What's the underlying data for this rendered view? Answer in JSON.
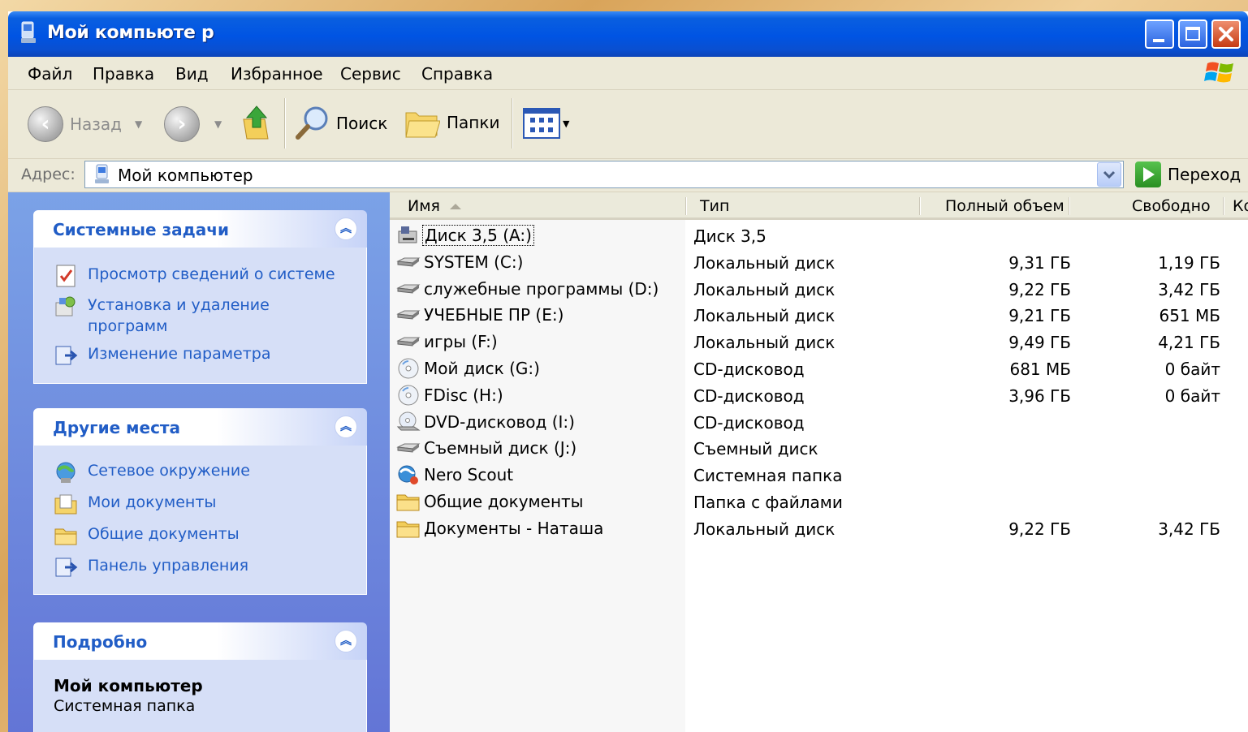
{
  "window": {
    "title": "Мой компьюте р"
  },
  "menu": [
    "Файл",
    "Правка",
    "Вид",
    "Избранное",
    "Сервис",
    "Справка"
  ],
  "toolbar": {
    "back_label": "Назад",
    "search_label": "Поиск",
    "folders_label": "Папки"
  },
  "address": {
    "label": "Адрес:",
    "value": "Мой компьютер",
    "go_label": "Переход"
  },
  "system_tasks": {
    "title": "Системные задачи",
    "items": [
      {
        "label": "Просмотр сведений о системе",
        "icon": "system-info-icon"
      },
      {
        "label": "Установка и удаление программ",
        "icon": "add-remove-programs-icon"
      },
      {
        "label": "Изменение параметра",
        "icon": "control-panel-icon"
      }
    ]
  },
  "other_places": {
    "title": "Другие места",
    "items": [
      {
        "label": "Сетевое окружение",
        "icon": "network-icon"
      },
      {
        "label": "Мои документы",
        "icon": "my-documents-icon"
      },
      {
        "label": "Общие документы",
        "icon": "folder-icon"
      },
      {
        "label": "Панель управления",
        "icon": "control-panel-icon"
      }
    ]
  },
  "details": {
    "title": "Подробно",
    "name": "Мой компьютер",
    "type": "Системная папка"
  },
  "columns": {
    "name": "Имя",
    "type": "Тип",
    "total": "Полный объем",
    "free": "Свободно",
    "extra": "Ко"
  },
  "files": [
    {
      "name": "Диск 3,5 (A:)",
      "type": "Диск 3,5",
      "total": "",
      "free": "",
      "icon": "floppy-drive-icon"
    },
    {
      "name": "SYSTEM (C:)",
      "type": "Локальный диск",
      "total": "9,31 ГБ",
      "free": "1,19 ГБ",
      "icon": "hard-drive-icon"
    },
    {
      "name": "служебные программы (D:)",
      "type": "Локальный диск",
      "total": "9,22 ГБ",
      "free": "3,42 ГБ",
      "icon": "hard-drive-icon"
    },
    {
      "name": "УЧЕБНЫЕ ПР (E:)",
      "type": "Локальный диск",
      "total": "9,21 ГБ",
      "free": "651 МБ",
      "icon": "hard-drive-icon"
    },
    {
      "name": "игры (F:)",
      "type": "Локальный диск",
      "total": "9,49 ГБ",
      "free": "4,21 ГБ",
      "icon": "hard-drive-icon"
    },
    {
      "name": "Мой диск (G:)",
      "type": "CD-дисковод",
      "total": "681 МБ",
      "free": "0 байт",
      "icon": "cd-drive-icon"
    },
    {
      "name": "FDisc (H:)",
      "type": "CD-дисковод",
      "total": "3,96 ГБ",
      "free": "0 байт",
      "icon": "cd-drive-icon"
    },
    {
      "name": "DVD-дисковод (I:)",
      "type": "CD-дисковод",
      "total": "",
      "free": "",
      "icon": "dvd-drive-icon"
    },
    {
      "name": "Съемный диск (J:)",
      "type": "Съемный диск",
      "total": "",
      "free": "",
      "icon": "removable-drive-icon"
    },
    {
      "name": "Nero Scout",
      "type": "Системная папка",
      "total": "",
      "free": "",
      "icon": "nero-scout-icon"
    },
    {
      "name": "Общие документы",
      "type": "Папка с файлами",
      "total": "",
      "free": "",
      "icon": "folder-icon"
    },
    {
      "name": "Документы - Наташа",
      "type": "Локальный диск",
      "total": "9,22 ГБ",
      "free": "3,42 ГБ",
      "icon": "folder-icon"
    }
  ]
}
